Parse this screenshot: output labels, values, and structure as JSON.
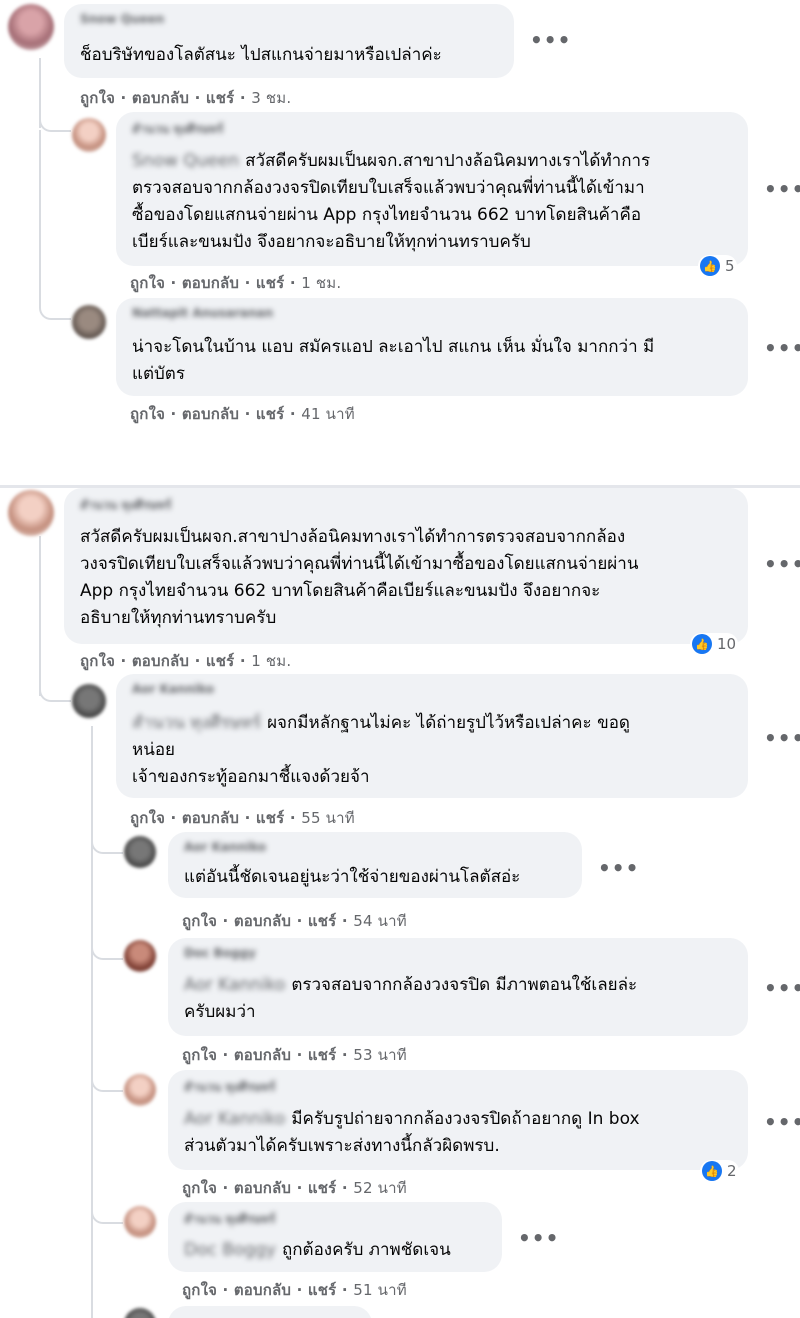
{
  "labels": {
    "like": "ถูกใจ",
    "reply": "ตอบกลับ",
    "share": "แชร์",
    "dot": "·"
  },
  "icons": {
    "more": "more-horizontal-icon",
    "like": "thumbs-up-icon"
  },
  "colors": {
    "bubble": "#f0f2f5",
    "muted": "#65676b",
    "like": "#1877f2"
  },
  "thread1": {
    "c1": {
      "author": "Snow Queen",
      "text": "ช็อบริษัทของโลตัสนะ ไปสแกนจ่ายมาหรือเปล่าค่ะ",
      "time": "3 ชม."
    },
    "c2": {
      "author": "สำนวน ทุงศีรษทร์",
      "tag": "Snow Queen",
      "lines": [
        "สวัสดีครับผมเป็นผจก.สาขาปางล้อนิคมทางเราได้ทำการ",
        "ตรวจสอบจากกล้องวงจรปิดเทียบใบเสร็จแล้วพบว่าคุณพี่ท่านนี้ได้เข้ามา",
        "ซื้อของโดยแสกนจ่ายผ่าน App กรุงไทยจำนวน 662 บาทโดยสินค้าคือ",
        "เบียร์และขนมปัง จึงอยากจะอธิบายให้ทุกท่านทราบครับ"
      ],
      "reactions": "5",
      "time": "1 ชม."
    },
    "c3": {
      "author": "Nattapit Anusaranan",
      "lines": [
        "น่าจะโดนในบ้าน แอบ สมัครแอป ละเอาไป สแกน เห็น มั่นใจ มากกว่า มี",
        "แต่บัตร"
      ],
      "time": "41 นาที"
    }
  },
  "thread2": {
    "c1": {
      "author": "สำนวน ทุงศีรษทร์",
      "lines": [
        "สวัสดีครับผมเป็นผจก.สาขาปางล้อนิคมทางเราได้ทำการตรวจสอบจากกล้อง",
        "วงจรปิดเทียบใบเสร็จแล้วพบว่าคุณพี่ท่านนี้ได้เข้ามาซื้อของโดยแสกนจ่ายผ่าน",
        "App กรุงไทยจำนวน 662 บาทโดยสินค้าคือเบียร์และขนมปัง จึงอยากจะ",
        "อธิบายให้ทุกท่านทราบครับ"
      ],
      "reactions": "10",
      "time": "1 ชม."
    },
    "c2": {
      "author": "Aor Kanniko",
      "tag": "สำนวน ทุงศีรษทร์",
      "lines": [
        "ผจกมีหลักฐานไม่คะ ได้ถ่ายรูปไว้หรือเปล่าคะ ขอดู",
        "หน่อย",
        "เจ้าของกระทู้ออกมาชี้แจงด้วยจ้า"
      ],
      "time": "55 นาที"
    },
    "c3": {
      "author": "Aor Kanniko",
      "text": "แต่อันนี้ชัดเจนอยู่นะว่าใช้จ่ายของผ่านโลตัสอ่ะ",
      "time": "54 นาที"
    },
    "c4": {
      "author": "Doc Boggy",
      "tag": "Aor Kanniko",
      "lines": [
        "ตรวจสอบจากกล้องวงจรปิด มีภาพตอนใช้เลยล่ะ",
        "ครับผมว่า"
      ],
      "time": "53 นาที"
    },
    "c5": {
      "author": "สำนวน ทุงศีรษทร์",
      "tag": "Aor Kanniko",
      "lines": [
        "มีครับรูปถ่ายจากกล้องวงจรปิดถ้าอยากดู In box",
        "ส่วนตัวมาได้ครับเพราะส่งทางนี้กลัวผิดพรบ."
      ],
      "reactions": "2",
      "time": "52 นาที"
    },
    "c6": {
      "author": "สำนวน ทุงศีรษทร์",
      "tag": "Doc Boggy",
      "text": "ถูกต้องครับ ภาพชัดเจน",
      "time": "51 นาที"
    }
  }
}
